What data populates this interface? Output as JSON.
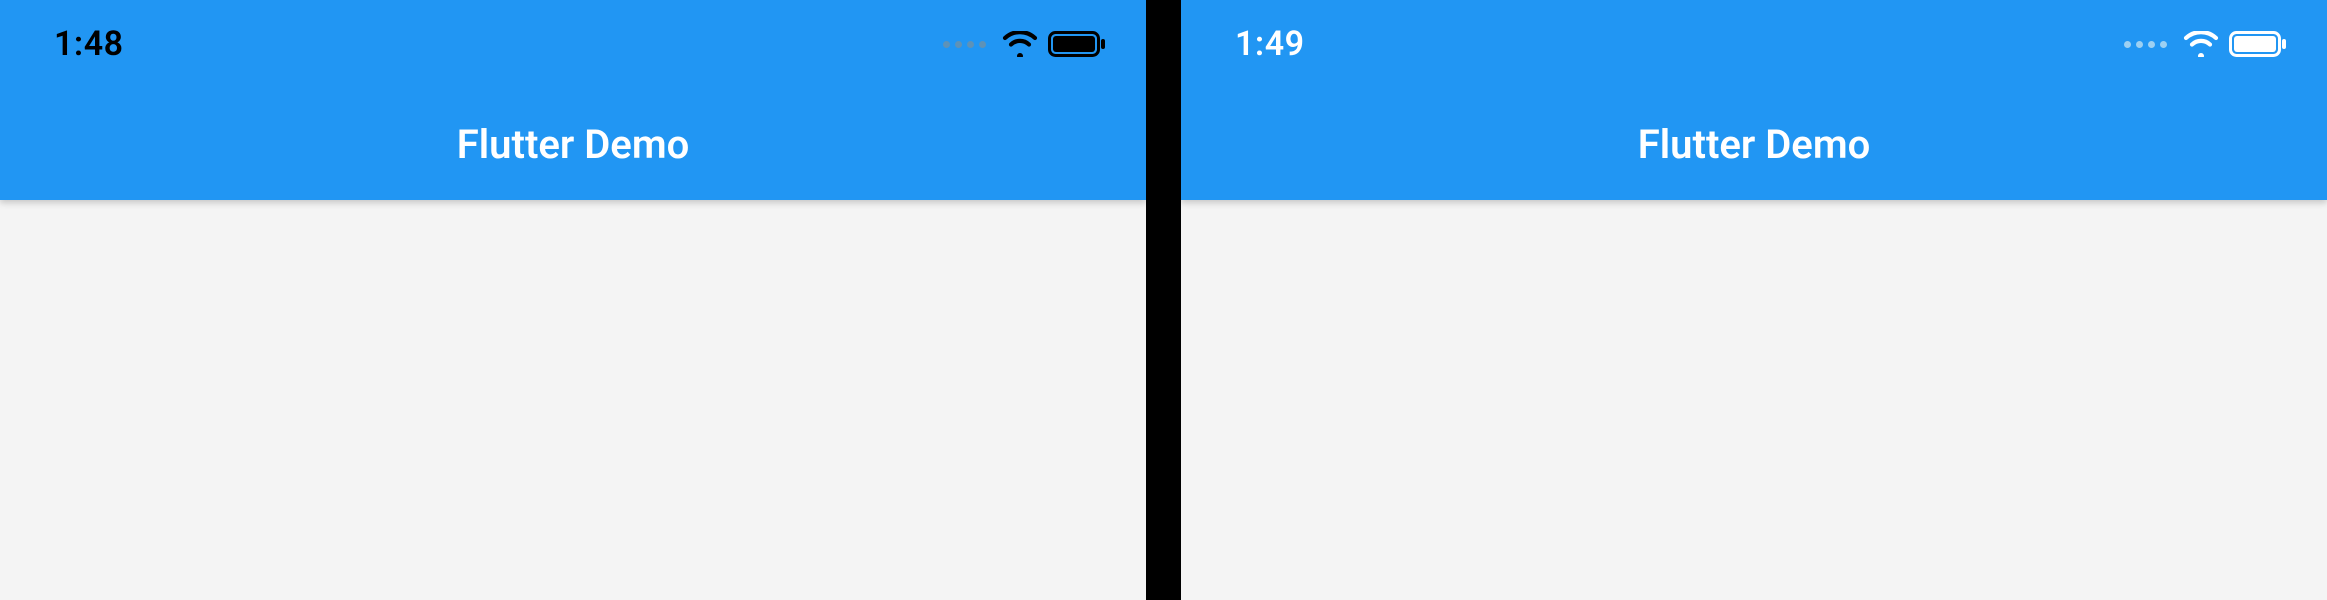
{
  "screens": [
    {
      "status": {
        "time": "1:48",
        "style": "dark"
      },
      "appbar": {
        "title": "Flutter Demo"
      },
      "colors": {
        "appbar_bg": "#2196f3",
        "body_bg": "#f4f4f4",
        "status_fg": "#000000",
        "dots": "#5e92b7"
      }
    },
    {
      "status": {
        "time": "1:49",
        "style": "light"
      },
      "appbar": {
        "title": "Flutter Demo"
      },
      "colors": {
        "appbar_bg": "#2196f3",
        "body_bg": "#f4f4f4",
        "status_fg": "#ffffff",
        "dots": "#9dd0f2"
      }
    }
  ]
}
